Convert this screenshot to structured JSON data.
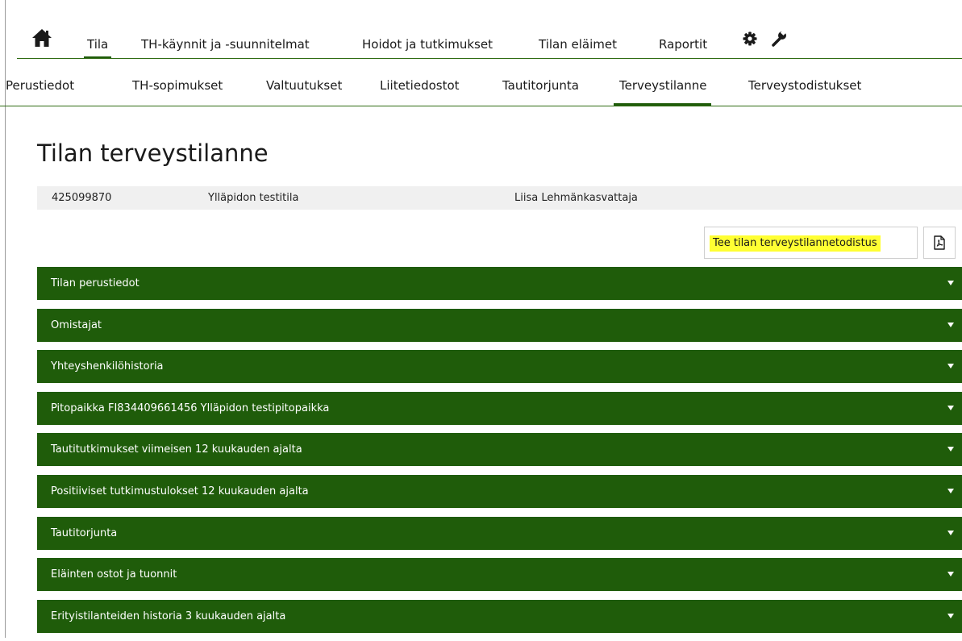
{
  "top_nav": {
    "home_icon": "home-icon",
    "items": [
      "Tila",
      "TH-käynnit ja -suunnitelmat",
      "Hoidot ja tutkimukset",
      "Tilan eläimet",
      "Raportit"
    ],
    "active": "Tila",
    "icons": [
      "gear-icon",
      "wrench-icon"
    ]
  },
  "sub_nav": {
    "items": [
      "Perustiedot",
      "TH-sopimukset",
      "Valtuutukset",
      "Liitetiedostot",
      "Tautitorjunta",
      "Terveystilanne",
      "Terveystodistukset"
    ],
    "active": "Terveystilanne"
  },
  "page_title": "Tilan terveystilanne",
  "farm_info": {
    "id": "425099870",
    "name": "Ylläpidon testitila",
    "owner": "Liisa Lehmänkasvattaja"
  },
  "actions": {
    "create_certificate_label": "Tee tilan terveystilannetodistus",
    "pdf_icon": "pdf-icon"
  },
  "sections": [
    "Tilan perustiedot",
    "Omistajat",
    "Yhteyshenkilöhistoria",
    "Pitopaikka FI834409661456 Ylläpidon testipitopaikka",
    "Tautitutkimukset viimeisen 12 kuukauden ajalta",
    "Positiiviset tutkimustulokset 12 kuukauden ajalta",
    "Tautitorjunta",
    "Eläinten ostot ja tuonnit",
    "Erityistilanteiden historia 3 kuukauden ajalta"
  ],
  "colors": {
    "accent_green": "#1f5c0a",
    "highlight": "#ffff33",
    "info_bar_bg": "#f0f0f0"
  }
}
